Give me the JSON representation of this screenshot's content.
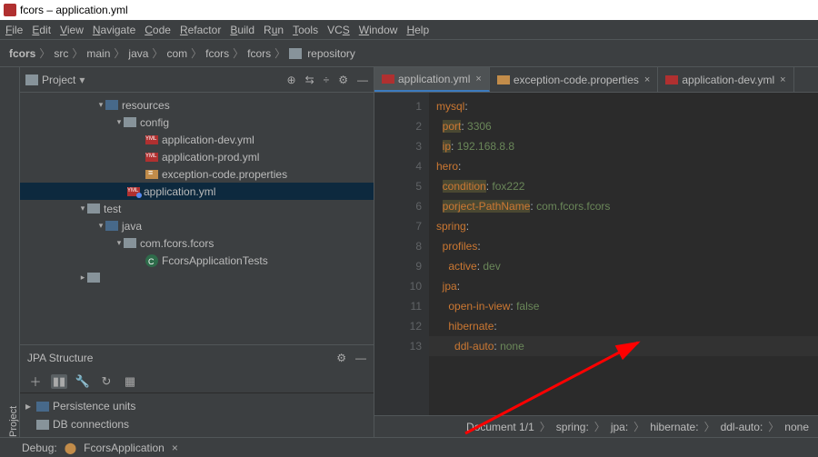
{
  "title": "fcors – application.yml",
  "menus": [
    "File",
    "Edit",
    "View",
    "Navigate",
    "Code",
    "Refactor",
    "Build",
    "Run",
    "Tools",
    "VCS",
    "Window",
    "Help"
  ],
  "breadcrumb": [
    "fcors",
    "src",
    "main",
    "java",
    "com",
    "fcors",
    "fcors",
    "repository"
  ],
  "project": {
    "label": "Project"
  },
  "sidebar_tab": "Project",
  "tree": {
    "resources": "resources",
    "config": "config",
    "app_dev": "application-dev.yml",
    "app_prod": "application-prod.yml",
    "exc_props": "exception-code.properties",
    "app_yml": "application.yml",
    "test": "test",
    "java": "java",
    "pkg": "com.fcors.fcors",
    "cls": "FcorsApplicationTests"
  },
  "jpa": {
    "header": "JPA Structure",
    "persistence": "Persistence units",
    "db": "DB connections"
  },
  "tabs": {
    "t1": "application.yml",
    "t2": "exception-code.properties",
    "t3": "application-dev.yml"
  },
  "code": {
    "l1_k": "mysql",
    "l1_c": ":",
    "l2_k": "port",
    "l2_c": ": ",
    "l2_v": "3306",
    "l3_k": "ip",
    "l3_c": ": ",
    "l3_v": "192.168.8.8",
    "l4_k": "hero",
    "l4_c": ":",
    "l5_k": "condition",
    "l5_c": ": ",
    "l5_v": "fox222",
    "l6_k": "porject-PathName",
    "l6_c": ": ",
    "l6_v": "com.fcors.fcors",
    "l7_k": "spring",
    "l7_c": ":",
    "l8_k": "profiles",
    "l8_c": ":",
    "l9_k": "active",
    "l9_c": ": ",
    "l9_v": "dev",
    "l10_k": "jpa",
    "l10_c": ":",
    "l11_k": "open-in-view",
    "l11_c": ": ",
    "l11_v": "false",
    "l12_k": "hibernate",
    "l12_c": ":",
    "l13_k": "ddl-auto",
    "l13_c": ": ",
    "l13_v": "none"
  },
  "status": {
    "doc": "Document 1/1",
    "p1": "spring:",
    "p2": "jpa:",
    "p3": "hibernate:",
    "p4": "ddl-auto:",
    "p5": "none"
  },
  "debug": {
    "label": "Debug:",
    "config": "FcorsApplication"
  }
}
